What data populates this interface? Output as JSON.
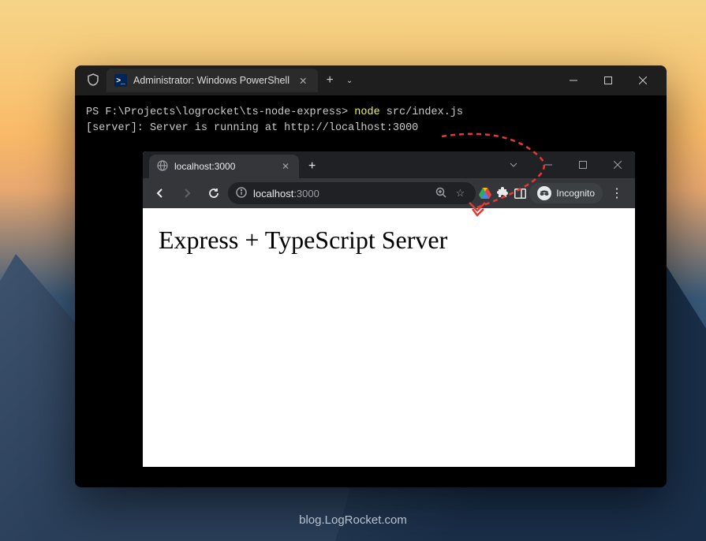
{
  "terminal": {
    "tab_title": "Administrator: Windows PowerShell",
    "prompt_prefix": "PS ",
    "prompt_path": "F:\\Projects\\logrocket\\ts-node-express>",
    "command_node": "node",
    "command_arg": "src/index.js",
    "output_line": "[server]: Server is running at http://localhost:3000",
    "new_tab_glyph": "+",
    "dropdown_glyph": "⌄"
  },
  "browser": {
    "tab_title": "localhost:3000",
    "address_host": "localhost",
    "address_port": ":3000",
    "incognito_label": "Incognito",
    "page_heading": "Express + TypeScript Server",
    "new_tab_glyph": "+",
    "dropdown_glyph": "⌄"
  },
  "footer": {
    "text": "blog.LogRocket.com"
  }
}
